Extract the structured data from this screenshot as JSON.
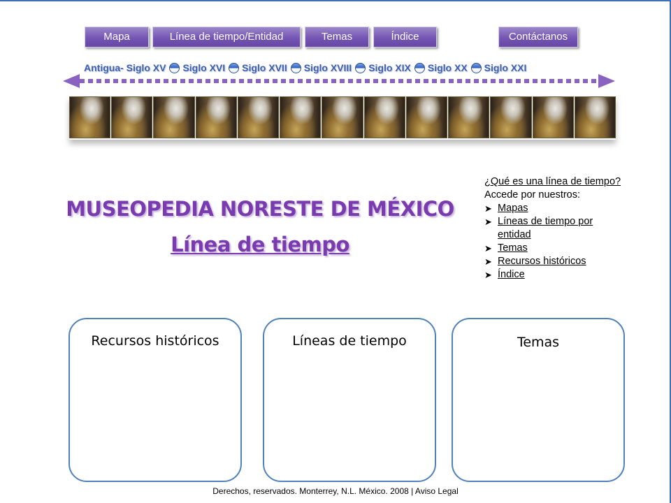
{
  "nav": {
    "items": [
      {
        "label": "Mapa"
      },
      {
        "label": "Línea de tiempo/Entidad"
      },
      {
        "label": "Temas"
      },
      {
        "label": "Índice"
      },
      {
        "label": "Contáctanos"
      }
    ]
  },
  "timeline": {
    "centuries": [
      {
        "label": "Antigua- Siglo XV"
      },
      {
        "label": "Siglo XVI"
      },
      {
        "label": "Siglo XVII"
      },
      {
        "label": "Siglo XVIII"
      },
      {
        "label": "Siglo XIX"
      },
      {
        "label": "Siglo XX"
      },
      {
        "label": "Siglo XXI"
      }
    ],
    "arrow_color": "#8a63c2"
  },
  "header": {
    "title": "MUSEOPEDIA NORESTE DE MÉXICO",
    "subtitle": "Línea de tiempo",
    "accent_color": "#7a3bb0"
  },
  "sidebar": {
    "question": "¿Qué es una línea de tiempo?",
    "intro": "Accede por nuestros:",
    "links": [
      {
        "label": "Mapas"
      },
      {
        "label": "Líneas de tiempo por entidad"
      },
      {
        "label": "Temas"
      },
      {
        "label": "Recursos históricos"
      },
      {
        "label": "Índice"
      }
    ]
  },
  "boxes": [
    {
      "title": "Recursos históricos"
    },
    {
      "title": "Líneas de tiempo"
    },
    {
      "title": "Temas"
    }
  ],
  "footer": {
    "copyright": "Derechos, reservados.  Monterrey, N.L. México. 2008 |",
    "legal_link": "Aviso Legal"
  }
}
